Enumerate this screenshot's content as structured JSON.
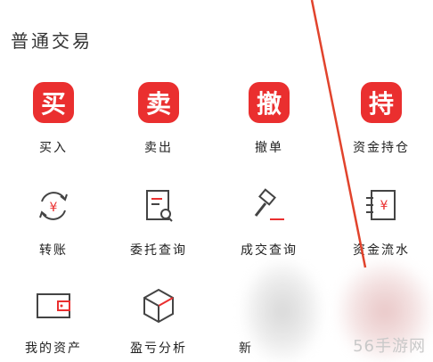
{
  "section": {
    "title": "普通交易"
  },
  "row1": [
    {
      "badge": "买",
      "label": "买入"
    },
    {
      "badge": "卖",
      "label": "卖出"
    },
    {
      "badge": "撤",
      "label": "撤单"
    },
    {
      "badge": "持",
      "label": "资金持仓"
    }
  ],
  "row2": [
    {
      "icon": "transfer-icon",
      "label": "转账"
    },
    {
      "icon": "order-query-icon",
      "label": "委托查询"
    },
    {
      "icon": "deal-query-icon",
      "label": "成交查询"
    },
    {
      "icon": "fund-flow-icon",
      "label": "资金流水"
    }
  ],
  "row3": [
    {
      "icon": "wallet-icon",
      "label": "我的资产"
    },
    {
      "icon": "profit-analysis-icon",
      "label": "盈亏分析"
    },
    {
      "icon": "blurred-icon",
      "label": "新"
    }
  ],
  "watermark": "56手游网",
  "colors": {
    "accent": "#ea2f2f",
    "icon_gray": "#444444"
  }
}
